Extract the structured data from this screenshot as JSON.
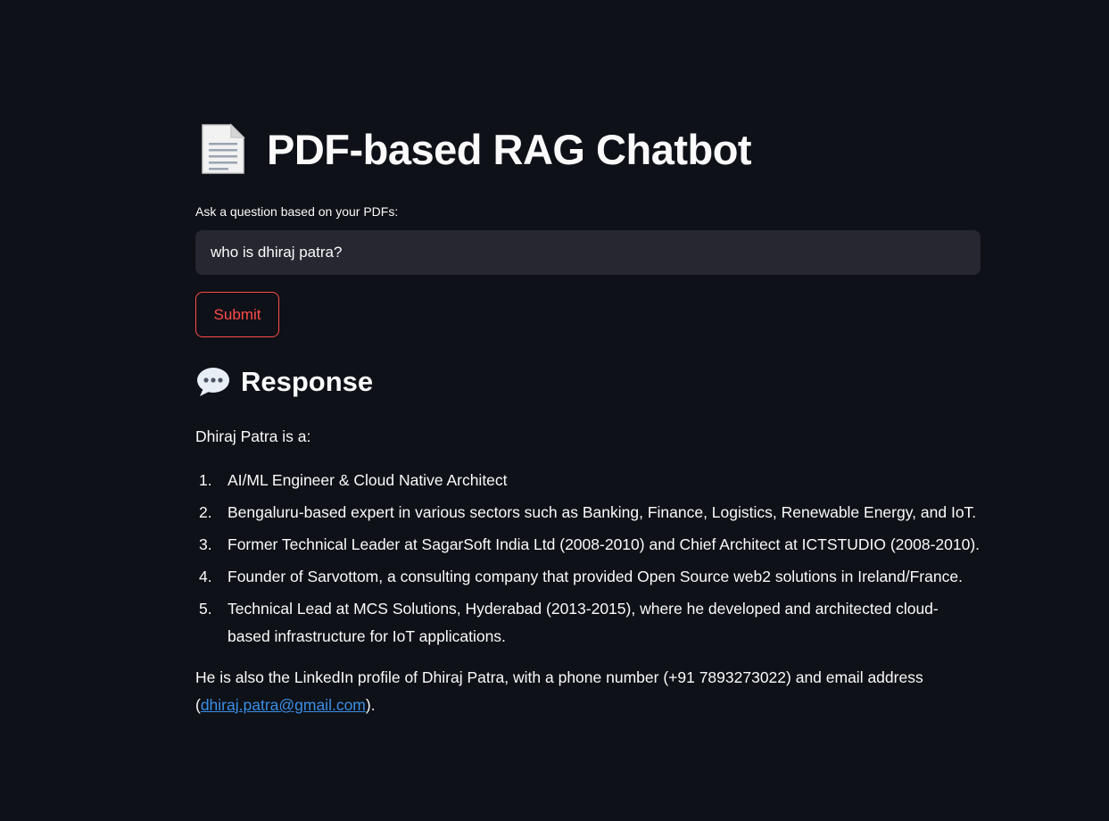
{
  "header": {
    "title_icon": "page-facing-up-icon",
    "title": "PDF-based RAG Chatbot"
  },
  "query": {
    "label": "Ask a question based on your PDFs:",
    "value": "who is dhiraj patra?"
  },
  "submit": {
    "label": "Submit"
  },
  "response": {
    "heading_icon": "speech-balloon-icon",
    "heading": "Response",
    "intro": "Dhiraj Patra is a:",
    "items": [
      {
        "num": "1.",
        "text": "AI/ML Engineer & Cloud Native Architect"
      },
      {
        "num": "2.",
        "text": "Bengaluru-based expert in various sectors such as Banking, Finance, Logistics, Renewable Energy, and IoT."
      },
      {
        "num": "3.",
        "text": "Former Technical Leader at SagarSoft India Ltd (2008-2010) and Chief Architect at ICTSTUDIO (2008-2010)."
      },
      {
        "num": "4.",
        "text": "Founder of Sarvottom, a consulting company that provided Open Source web2 solutions in Ireland/France."
      },
      {
        "num": "5.",
        "text": "Technical Lead at MCS Solutions, Hyderabad (2013-2015), where he developed and architected cloud-based infrastructure for IoT applications."
      }
    ],
    "outro_prefix": "He is also the LinkedIn profile of Dhiraj Patra, with a phone number (+91 7893273022) and email address (",
    "email": "dhiraj.patra@gmail.com",
    "outro_suffix": ")."
  },
  "colors": {
    "background": "#0e1117",
    "input_bg": "#262730",
    "accent": "#ff4b4b",
    "link": "#3a8ee6"
  }
}
